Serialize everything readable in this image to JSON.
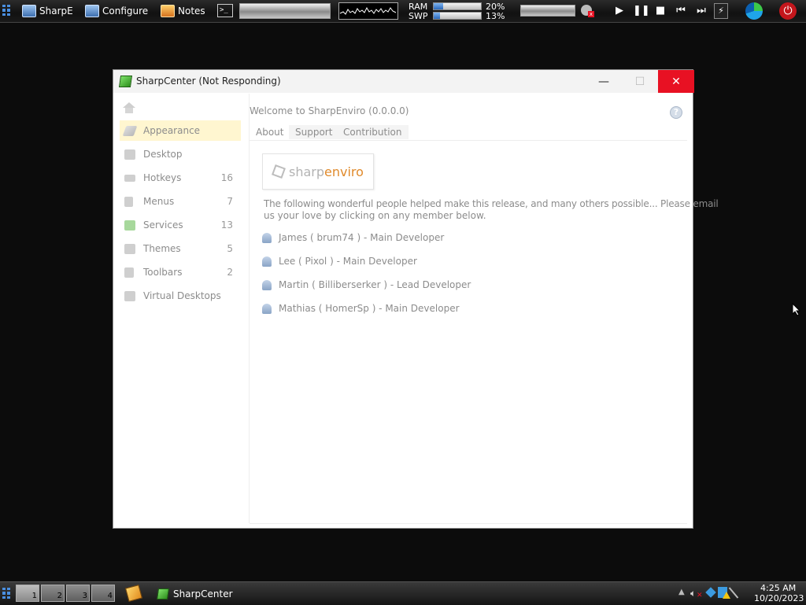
{
  "topbar": {
    "btn_sharpe": "SharpE",
    "btn_configure": "Configure",
    "btn_notes": "Notes",
    "ram_label": "RAM",
    "swp_label": "SWP",
    "ram_percent": "20%",
    "swp_percent": "13%",
    "ram_fraction": 0.2,
    "swp_fraction": 0.13
  },
  "window": {
    "title": "SharpCenter (Not Responding)",
    "minimize": "—",
    "maximize": "☐",
    "close": "✕"
  },
  "sidebar": {
    "items": [
      {
        "label": "Appearance",
        "count": ""
      },
      {
        "label": "Desktop",
        "count": ""
      },
      {
        "label": "Hotkeys",
        "count": "16"
      },
      {
        "label": "Menus",
        "count": "7"
      },
      {
        "label": "Services",
        "count": "13"
      },
      {
        "label": "Themes",
        "count": "5"
      },
      {
        "label": "Toolbars",
        "count": "2"
      },
      {
        "label": "Virtual Desktops",
        "count": ""
      }
    ]
  },
  "content": {
    "heading": "Welcome to SharpEnviro (0.0.0.0)",
    "tabs": [
      "About",
      "Support",
      "Contribution"
    ],
    "logo_sharp": "sharp",
    "logo_enviro": "enviro",
    "intro_line1": "The following wonderful people helped make this release, and many others possible... Please email",
    "intro_line2": "us your love by clicking on any member below.",
    "members": [
      "James ( brum74 ) -  Main Developer",
      "Lee ( Pixol ) -  Main Developer",
      "Martin ( Billiberserker ) -  Lead Developer",
      "Mathias ( HomerSp ) -  Main Developer"
    ]
  },
  "taskbar": {
    "desktops": [
      "1",
      "2",
      "3",
      "4"
    ],
    "task_label": "SharpCenter",
    "time": "4:25 AM",
    "date": "10/20/2023"
  },
  "colors": {
    "close_red": "#e81123",
    "active_item": "#fff6d0",
    "logo_orange": "#e08a2b"
  }
}
